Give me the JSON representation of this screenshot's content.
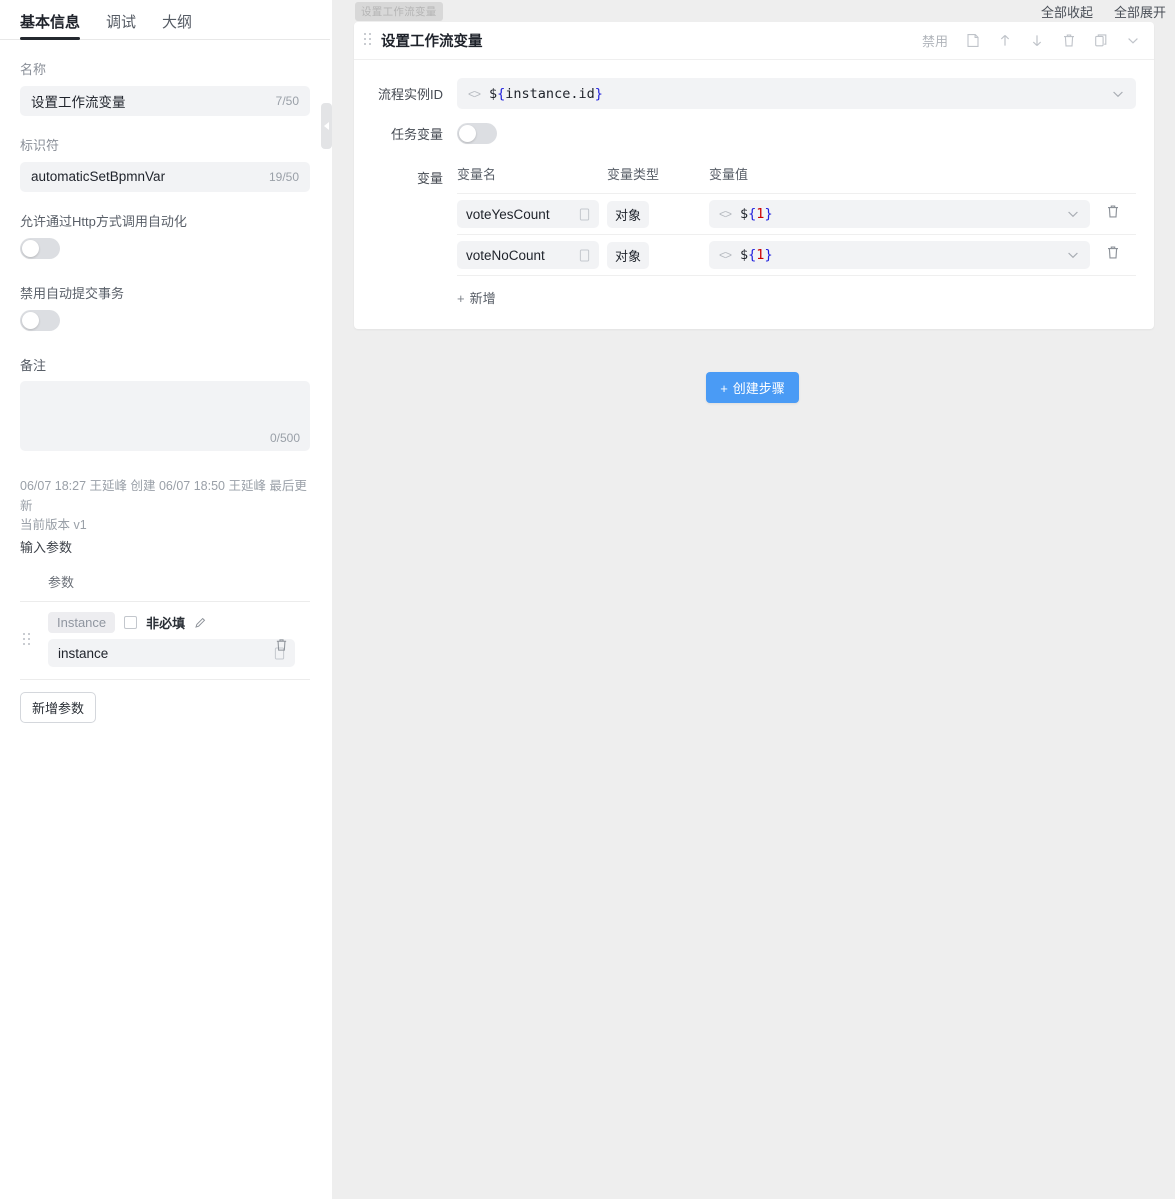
{
  "left": {
    "tabs": [
      {
        "label": "基本信息",
        "active": true
      },
      {
        "label": "调试",
        "active": false
      },
      {
        "label": "大纲",
        "active": false
      }
    ],
    "name_label": "名称",
    "name_value": "设置工作流变量",
    "name_counter": "7/50",
    "identifier_label": "标识符",
    "identifier_value": "automaticSetBpmnVar",
    "identifier_counter": "19/50",
    "http_toggle_label": "允许通过Http方式调用自动化",
    "http_toggle_state": "off",
    "disable_autocommit_label": "禁用自动提交事务",
    "disable_autocommit_state": "off",
    "remark_label": "备注",
    "remark_value": "",
    "remark_counter": "0/500",
    "meta_line": "06/07 18:27 王延峰 创建 06/07 18:50 王延峰 最后更新",
    "version_line": "当前版本 v1",
    "input_params_title": "输入参数",
    "param_column_header": "参数",
    "param": {
      "chip": "Instance",
      "optional_label": "非必填",
      "optional_checked": false,
      "value": "instance"
    },
    "add_param_button": "新增参数"
  },
  "right": {
    "breadcrumb_chip": "设置工作流变量",
    "collapse_all": "全部收起",
    "expand_all": "全部展开",
    "card": {
      "title": "设置工作流变量",
      "tool_disable": "禁用",
      "tools": [
        "note-icon",
        "move-up-icon",
        "move-down-icon",
        "delete-icon",
        "copy-icon",
        "chevron-down-icon"
      ],
      "instance_id_label": "流程实例ID",
      "instance_id_value": "${instance.id}",
      "instance_id_parts": {
        "prefix": "$",
        "open": "{",
        "inner": "instance.id",
        "close": "}"
      },
      "task_var_label": "任务变量",
      "task_var_state": "off",
      "vars_label": "变量",
      "columns": [
        "变量名",
        "变量类型",
        "变量值"
      ],
      "rows": [
        {
          "name": "voteYesCount",
          "type": "对象",
          "value": "${1}",
          "value_prefix": "$",
          "value_open": "{",
          "value_num": "1",
          "value_close": "}"
        },
        {
          "name": "voteNoCount",
          "type": "对象",
          "value": "${1}",
          "value_prefix": "$",
          "value_open": "{",
          "value_num": "1",
          "value_close": "}"
        }
      ],
      "add_row_label": "新增"
    },
    "create_step_button": "创建步骤"
  },
  "colors": {
    "accent": "#4a9bf5",
    "panel_bg": "#eeeeee",
    "field_bg": "#f2f3f5",
    "brace_blue": "#2020dd",
    "num_red": "#cc0000"
  }
}
